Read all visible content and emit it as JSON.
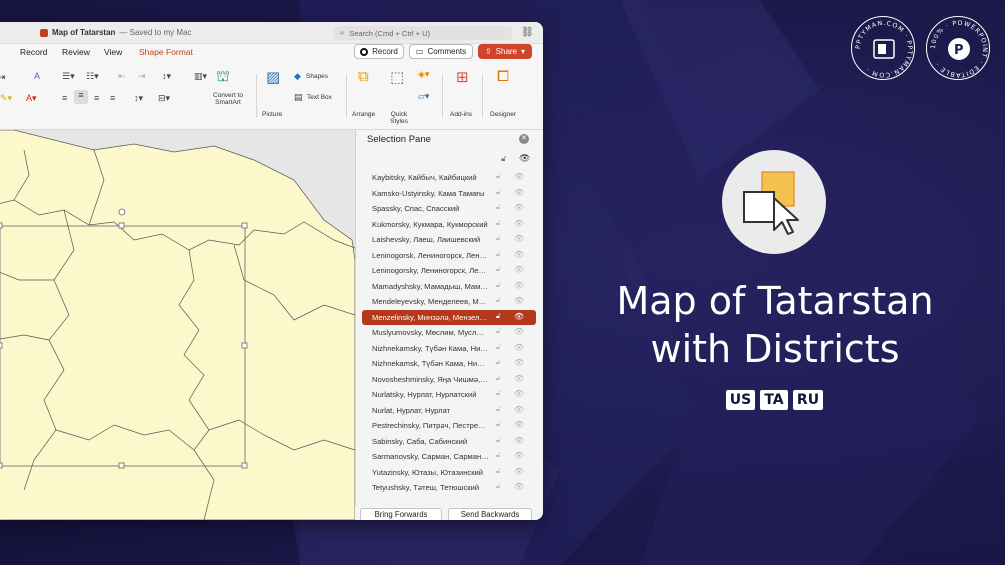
{
  "window": {
    "doc_title": "Map of Tatarstan",
    "doc_status": "— Saved to my Mac",
    "search_placeholder": "Search (Cmd + Ctrl + U)"
  },
  "menu": [
    "Record",
    "Review",
    "View",
    "Shape Format"
  ],
  "menu_accent_color": "#c43e1c",
  "header_buttons": {
    "record": "Record",
    "comments": "Comments",
    "share": "Share"
  },
  "ribbon": {
    "convert_smartart": "Convert to SmartArt",
    "picture": "Picture",
    "shapes": "Shapes",
    "text_box": "Text Box",
    "arrange": "Arrange",
    "quick_styles": "Quick Styles",
    "add_ins": "Add-ins",
    "designer": "Designer"
  },
  "selection_pane": {
    "title": "Selection Pane",
    "items": [
      "Kaybitsky, Кайбыч, Кайбицкий",
      "Kamsko-Ustyinsky, Кама Тамағы",
      "Spassky, Спас, Спасский",
      "Kukmorsky, Кукмара, Кукморский",
      "Laishevsky, Лаеш, Лаишевский",
      "Leninogorsk, Лениногорск, Лениногорск",
      "Leninogorsky, Лениногорск, Лениногорский",
      "Mamadyshsky, Мамадыш, Мамадышский",
      "Mendeleyevsky, Менделеев, Менделеевский",
      "Menzelinsky, Минзәлә, Мензелинский",
      "Muslyumovsky, Мөслим, Муслюмовский",
      "Nizhnekamsky, Түбән Кама, Нижнекамский",
      "Nizhnekamsk, Түбән Кама, Нижнекамск",
      "Novosheshminsky, Яңа Чишмә, Новошешминский",
      "Nurlatsky, Нурлат, Нурлатский",
      "Nurlat, Нурлат, Нурлат",
      "Pestrechinsky, Питрәч, Пестречинский",
      "Sabinsky, Саба, Сабинский",
      "Sarmanovsky, Сарман, Сармановский",
      "Yutazinsky, Ютазы, Ютазинский",
      "Tetyushsky, Тәтеш, Тетюшский"
    ],
    "selected_index": 9,
    "bring_forwards": "Bring Forwards",
    "send_backwards": "Send Backwards"
  },
  "promo": {
    "title_line1": "Map of Tatarstan",
    "title_line2": "with Districts",
    "languages": [
      "US",
      "TA",
      "RU"
    ],
    "badge_left": "PPTYMAN.COM · PPTYMAN.COM ·",
    "badge_right": "100% · POWERPOINT · EDITABLE ·"
  },
  "colors": {
    "background": "#1f1c52",
    "map_fill": "#fdf7cc",
    "share_button": "#d0452a",
    "selected_row": "#b4391c"
  }
}
